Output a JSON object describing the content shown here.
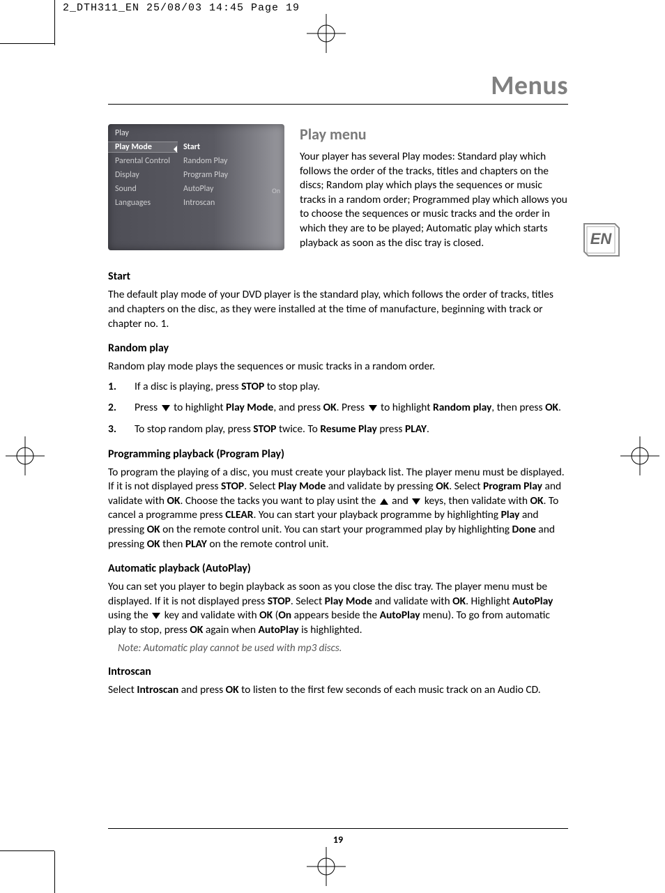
{
  "slug": "2_DTH311_EN  25/08/03  14:45  Page 19",
  "title": "Menus",
  "lang_badge": "EN",
  "page_number": "19",
  "osd": {
    "header": "Play",
    "left_items": [
      "Play Mode",
      "Parental Control",
      "Display",
      "Sound",
      "Languages"
    ],
    "right_items": [
      "Start",
      "Random Play",
      "Program Play",
      "AutoPlay",
      "Introscan"
    ],
    "autoplay_badge": "On"
  },
  "intro": {
    "heading": "Play menu",
    "text": "Your player has several Play modes: Standard play which follows the order of the tracks, titles and chapters on the discs; Random play which plays the sequences or music tracks in a random order; Programmed play which allows you to choose the sequences or music tracks and the order in which they are to be played; Automatic play which starts playback as soon as the disc tray is closed."
  },
  "sections": {
    "start": {
      "h": "Start",
      "p": "The default play mode of your DVD player is the standard play, which follows the order of tracks, titles and chapters on the disc, as they were installed at the time of manufacture, beginning with track or chapter no. 1."
    },
    "random": {
      "h": "Random play",
      "p": "Random play mode plays the sequences or music tracks in a random order.",
      "steps": {
        "s1_a": "If a disc is playing, press ",
        "s1_b": "STOP",
        "s1_c": " to stop play.",
        "s2_a": "Press ",
        "s2_b": " to highlight ",
        "s2_c": "Play Mode",
        "s2_d": ", and press ",
        "s2_e": "OK",
        "s2_f": ". Press ",
        "s2_g": " to highlight ",
        "s2_h": "Random play",
        "s2_i": ", then press ",
        "s2_j": "OK",
        "s2_k": ".",
        "s3_a": "To stop random play, press ",
        "s3_b": "STOP",
        "s3_c": " twice. To ",
        "s3_d": "Resume Play",
        "s3_e": " press ",
        "s3_f": "PLAY",
        "s3_g": "."
      }
    },
    "program": {
      "h": "Programming playback (Program Play)",
      "p_a": "To program the playing of a disc, you must create your playback list. The player menu must be displayed. If it is not displayed press ",
      "p_b": "STOP",
      "p_c": ". Select ",
      "p_d": "Play Mode",
      "p_e": " and validate by pressing ",
      "p_f": "OK",
      "p_g": ". Select ",
      "p_h": "Program Play",
      "p_i": " and validate with ",
      "p_j": "OK",
      "p_k": ". Choose the tacks you want to play usint the ",
      "p_l": " and ",
      "p_m": " keys, then validate with ",
      "p_n": "OK",
      "p_o": ". To cancel a programme press ",
      "p_p": "CLEAR",
      "p_q": ". You can start your playback programme by highlighting ",
      "p_r": "Play",
      "p_s": " and pressing ",
      "p_t": "OK",
      "p_u": " on the remote control unit. You can start your programmed play by highlighting ",
      "p_v": "Done",
      "p_w": " and pressing ",
      "p_x": "OK",
      "p_y": " then ",
      "p_z": "PLAY",
      "p_za": " on the remote control unit."
    },
    "auto": {
      "h": "Automatic playback (AutoPlay)",
      "p_a": "You can set you player to begin playback as soon as you close the disc tray. The player menu must be displayed. If it is not displayed press ",
      "p_b": "STOP",
      "p_c": ". Select ",
      "p_d": "Play Mode",
      "p_e": " and validate with ",
      "p_f": "OK",
      "p_g": ". Highlight ",
      "p_h": "AutoPlay",
      "p_i": " using the ",
      "p_j": " key and validate with ",
      "p_k": "OK",
      "p_l": " (",
      "p_m": "On",
      "p_n": " appears beside the ",
      "p_o": "AutoPlay",
      "p_p": " menu). To go from automatic play to stop, press ",
      "p_q": "OK",
      "p_r": " again when ",
      "p_s": "AutoPlay",
      "p_t": " is highlighted.",
      "note": "Note: Automatic play cannot be used with mp3 discs."
    },
    "intro_scan": {
      "h": "Introscan",
      "p_a": "Select ",
      "p_b": "Introscan",
      "p_c": " and press ",
      "p_d": "OK",
      "p_e": " to listen to the first few seconds of each music track on an Audio CD."
    }
  }
}
